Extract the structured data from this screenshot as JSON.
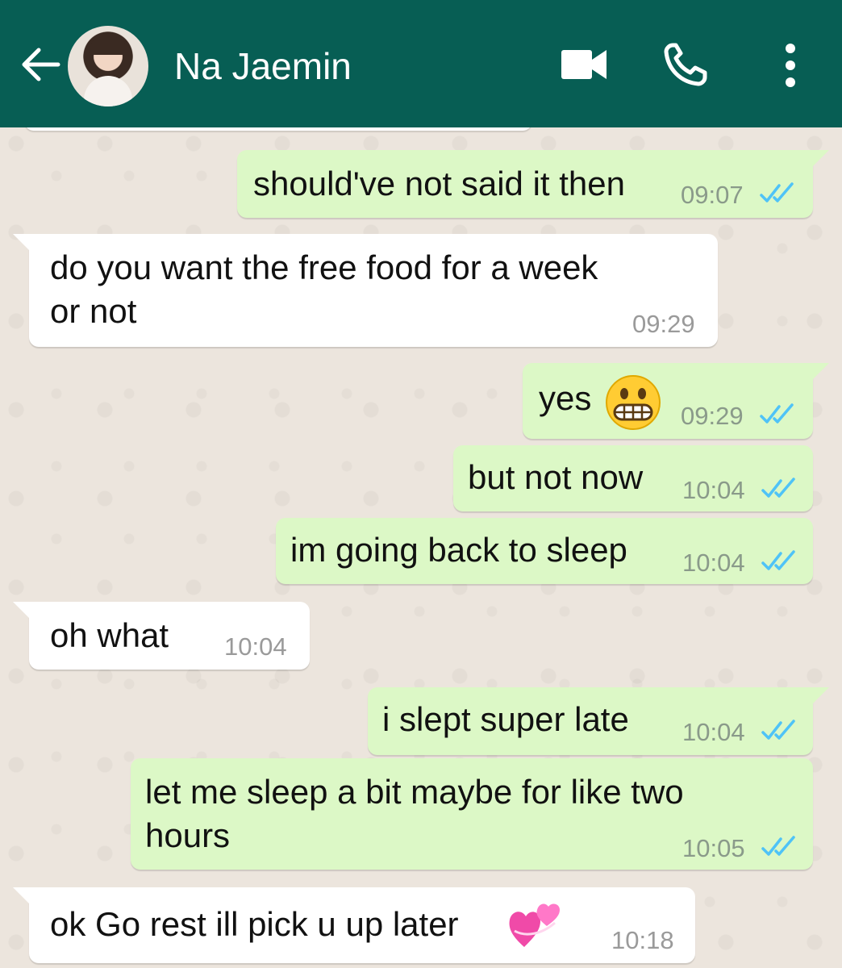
{
  "header": {
    "contact_name": "Na Jaemin",
    "icons": [
      "back-arrow-icon",
      "video-call-icon",
      "phone-icon",
      "more-options-icon"
    ],
    "background_color": "#075e54"
  },
  "messages": [
    {
      "direction": "out",
      "text": "should've not said it then",
      "time": "09:07",
      "status": "read"
    },
    {
      "direction": "in",
      "text_lines": [
        "do you want the free food for a week",
        "or not"
      ],
      "time": "09:29"
    },
    {
      "direction": "out",
      "text": "yes",
      "emoji": "grimacing-face",
      "time": "09:29",
      "status": "read"
    },
    {
      "direction": "out",
      "text": "but not now",
      "time": "10:04",
      "status": "read"
    },
    {
      "direction": "out",
      "text": "im going back to sleep",
      "time": "10:04",
      "status": "read"
    },
    {
      "direction": "in",
      "text": "oh what",
      "time": "10:04"
    },
    {
      "direction": "out",
      "text": "i slept super late",
      "time": "10:04",
      "status": "read"
    },
    {
      "direction": "out",
      "text_lines": [
        "let me sleep a bit maybe for like two",
        "hours"
      ],
      "time": "10:05",
      "status": "read"
    },
    {
      "direction": "in",
      "text": "ok Go rest ill pick u up later",
      "emoji": "two-hearts",
      "time": "10:18"
    }
  ],
  "colors": {
    "outgoing_bubble": "#dcf8c6",
    "incoming_bubble": "#ffffff",
    "read_ticks": "#4fc3f7",
    "chat_background": "#ece5dd"
  }
}
